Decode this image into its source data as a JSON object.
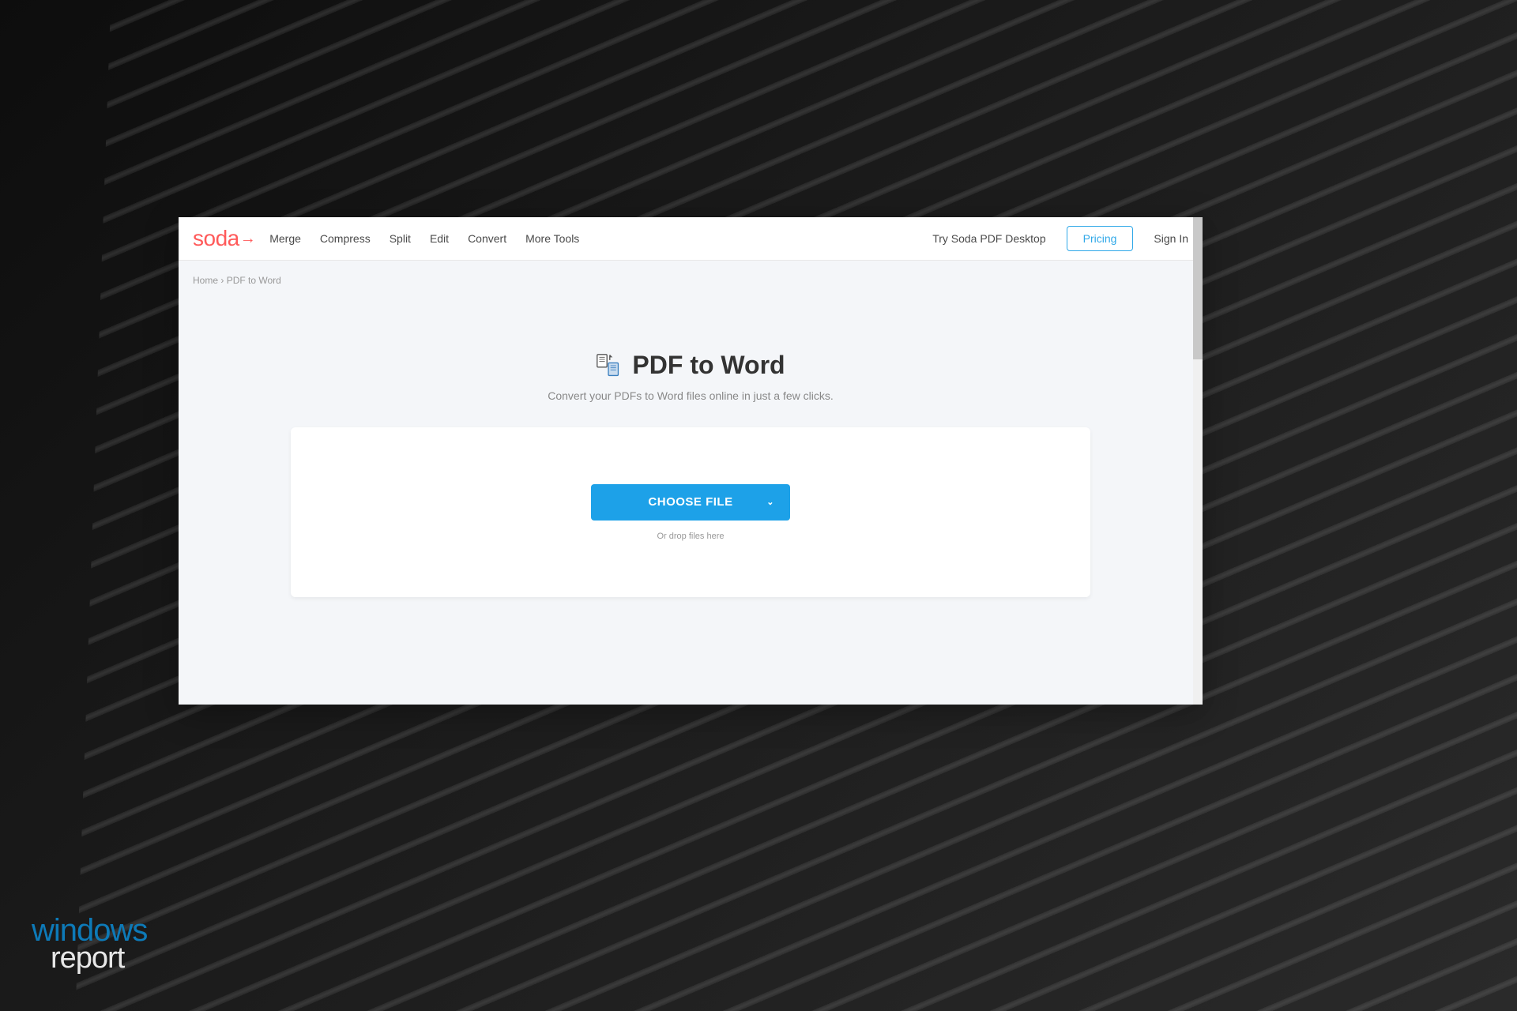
{
  "logo": {
    "text": "soda",
    "arrow": "→"
  },
  "nav": {
    "items": [
      {
        "label": "Merge"
      },
      {
        "label": "Compress"
      },
      {
        "label": "Split"
      },
      {
        "label": "Edit"
      },
      {
        "label": "Convert"
      },
      {
        "label": "More Tools"
      }
    ]
  },
  "header_right": {
    "try_desktop": "Try Soda PDF Desktop",
    "pricing": "Pricing",
    "sign_in": "Sign In"
  },
  "breadcrumb": {
    "home": "Home",
    "separator": "›",
    "current": "PDF to Word"
  },
  "main": {
    "title": "PDF to Word",
    "subtitle": "Convert your PDFs to Word files online in just a few clicks.",
    "choose_file": "CHOOSE FILE",
    "drop_text": "Or drop files here"
  },
  "watermark": {
    "top": "windows",
    "bottom": "report"
  },
  "colors": {
    "accent": "#1da1e8",
    "logo": "#ff5a5a"
  }
}
